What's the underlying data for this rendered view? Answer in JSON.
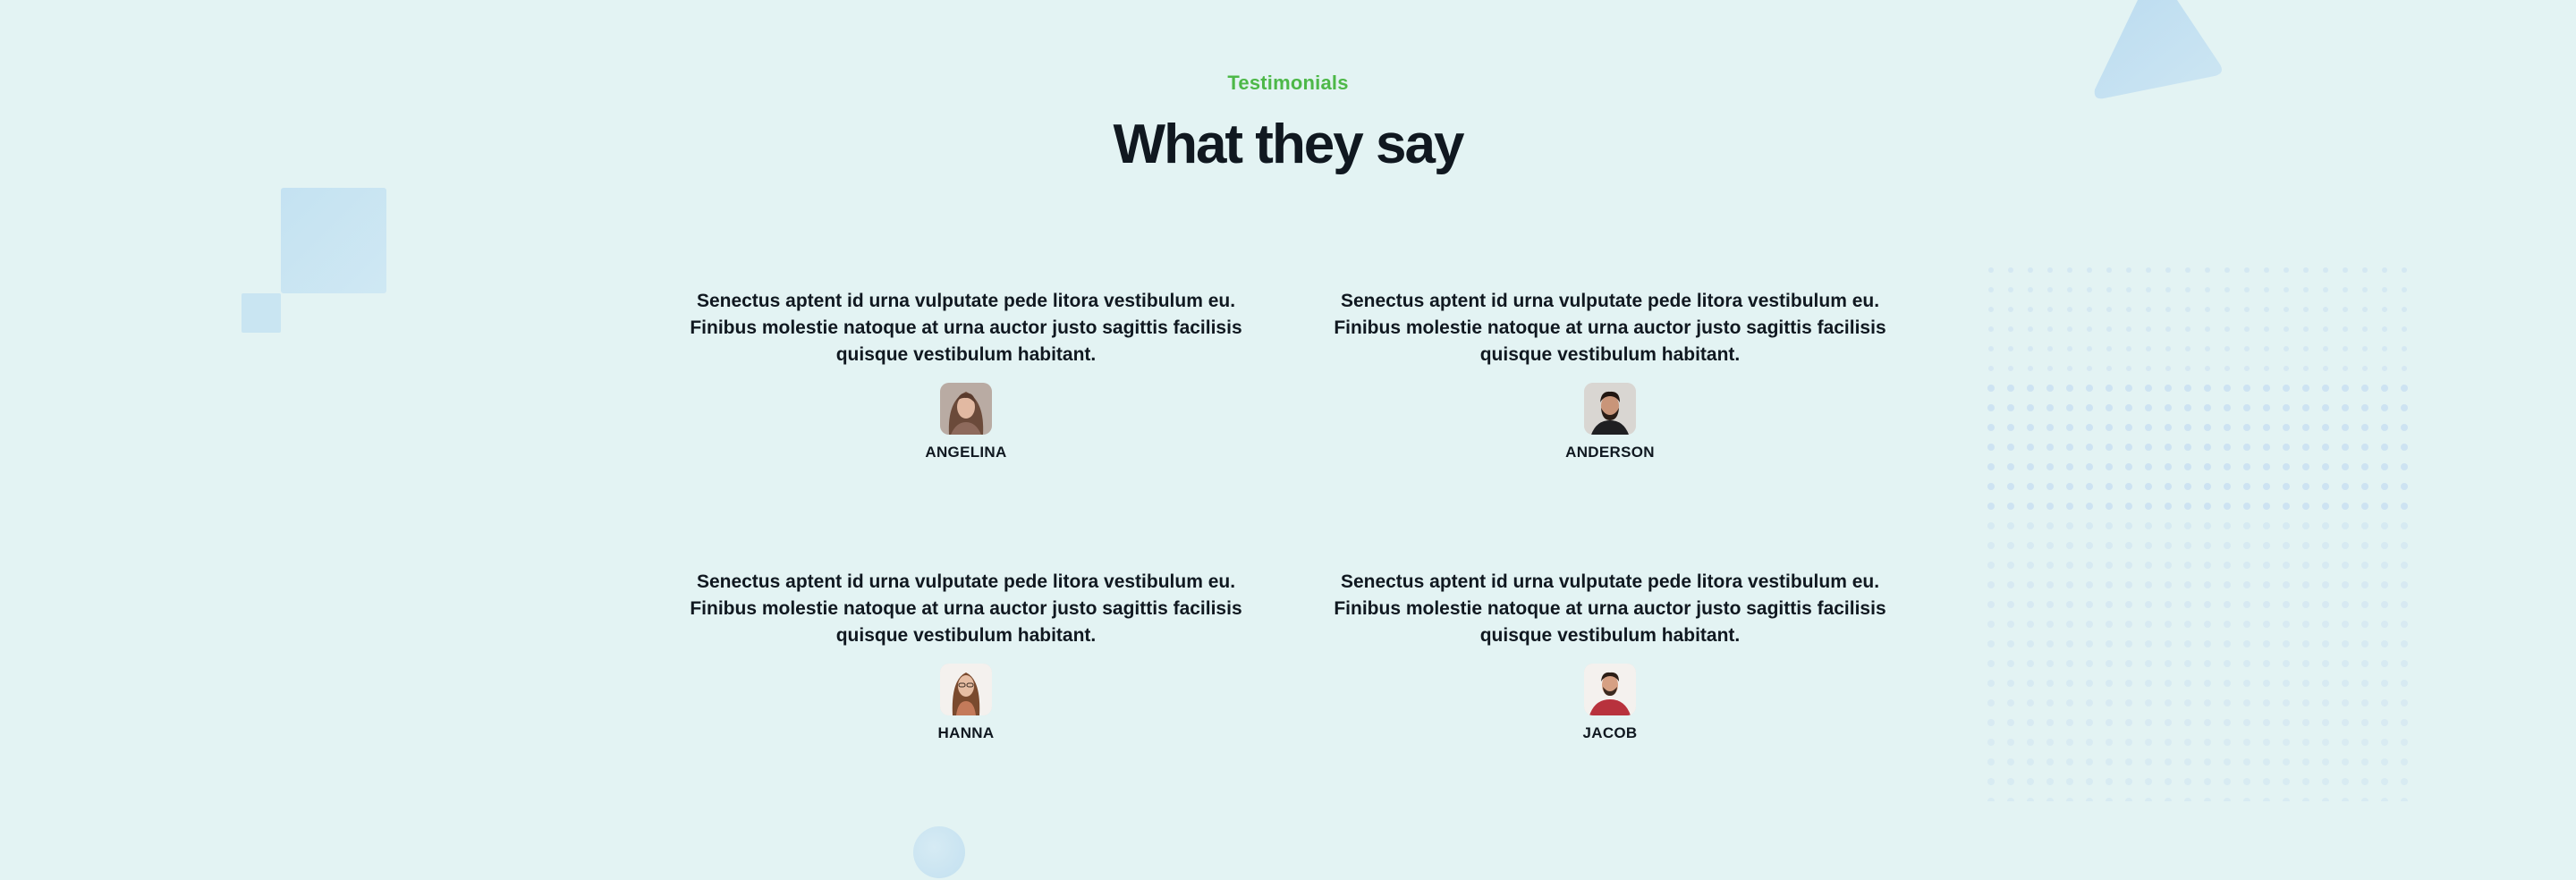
{
  "section": {
    "eyebrow": "Testimonials",
    "title": "What they say"
  },
  "testimonials": [
    {
      "quote": "Senectus aptent id urna vulputate pede litora vestibulum eu. Finibus molestie natoque at urna auctor justo sagittis facilisis quisque vestibulum habitant.",
      "name": "ANGELINA",
      "avatar": "woman-portrait-avatar"
    },
    {
      "quote": "Senectus aptent id urna vulputate pede litora vestibulum eu. Finibus molestie natoque at urna auctor justo sagittis facilisis quisque vestibulum habitant.",
      "name": "ANDERSON",
      "avatar": "man-bearded-portrait-avatar"
    },
    {
      "quote": "Senectus aptent id urna vulputate pede litora vestibulum eu. Finibus molestie natoque at urna auctor justo sagittis facilisis quisque vestibulum habitant.",
      "name": "HANNA",
      "avatar": "woman-glasses-portrait-avatar"
    },
    {
      "quote": "Senectus aptent id urna vulputate pede litora vestibulum eu. Finibus molestie natoque at urna auctor justo sagittis facilisis quisque vestibulum habitant.",
      "name": "JACOB",
      "avatar": "man-red-shirt-portrait-avatar"
    }
  ],
  "colors": {
    "background": "#e3f3f3",
    "accent": "#4db848",
    "text": "#101820",
    "decor": "#c4e2f2"
  }
}
